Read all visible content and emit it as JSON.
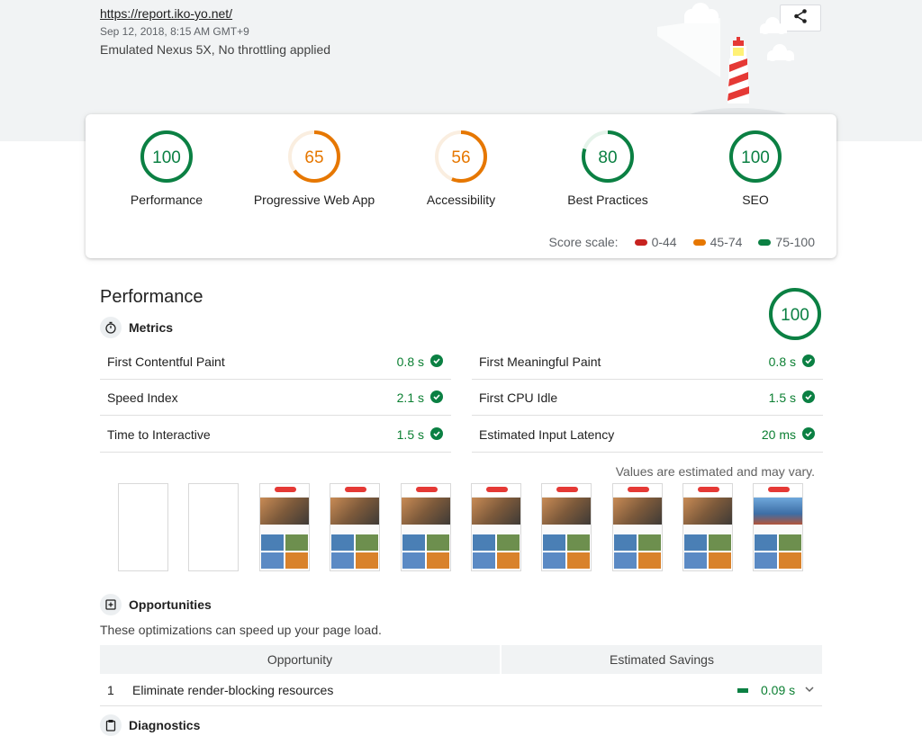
{
  "header": {
    "url": "https://report.iko-yo.net/",
    "datetime": "Sep 12, 2018, 8:15 AM GMT+9",
    "device": "Emulated Nexus 5X, No throttling applied"
  },
  "colors": {
    "pass": "#0b8043",
    "average": "#e67700",
    "fail": "#c7221f",
    "track_pass": "#e5f3ea",
    "track_average": "#faeee0"
  },
  "summary": {
    "gauges": [
      {
        "score": "100",
        "label": "Performance",
        "level": "pass"
      },
      {
        "score": "65",
        "label": "Progressive Web App",
        "level": "average"
      },
      {
        "score": "56",
        "label": "Accessibility",
        "level": "average"
      },
      {
        "score": "80",
        "label": "Best Practices",
        "level": "pass"
      },
      {
        "score": "100",
        "label": "SEO",
        "level": "pass"
      }
    ],
    "scale_title": "Score scale:",
    "scale": [
      "0-44",
      "45-74",
      "75-100"
    ]
  },
  "performance": {
    "title": "Performance",
    "score": "100",
    "metrics_title": "Metrics",
    "metrics": [
      {
        "name": "First Contentful Paint",
        "value": "0.8 s"
      },
      {
        "name": "First Meaningful Paint",
        "value": "0.8 s"
      },
      {
        "name": "Speed Index",
        "value": "2.1 s"
      },
      {
        "name": "First CPU Idle",
        "value": "1.5 s"
      },
      {
        "name": "Time to Interactive",
        "value": "1.5 s"
      },
      {
        "name": "Estimated Input Latency",
        "value": "20 ms"
      }
    ],
    "estimate_note": "Values are estimated and may vary."
  },
  "opportunities": {
    "title": "Opportunities",
    "description": "These optimizations can speed up your page load.",
    "col_opportunity": "Opportunity",
    "col_savings": "Estimated Savings",
    "rows": [
      {
        "num": "1",
        "title": "Eliminate render-blocking resources",
        "savings": "0.09 s"
      }
    ]
  },
  "diagnostics": {
    "title": "Diagnostics"
  }
}
